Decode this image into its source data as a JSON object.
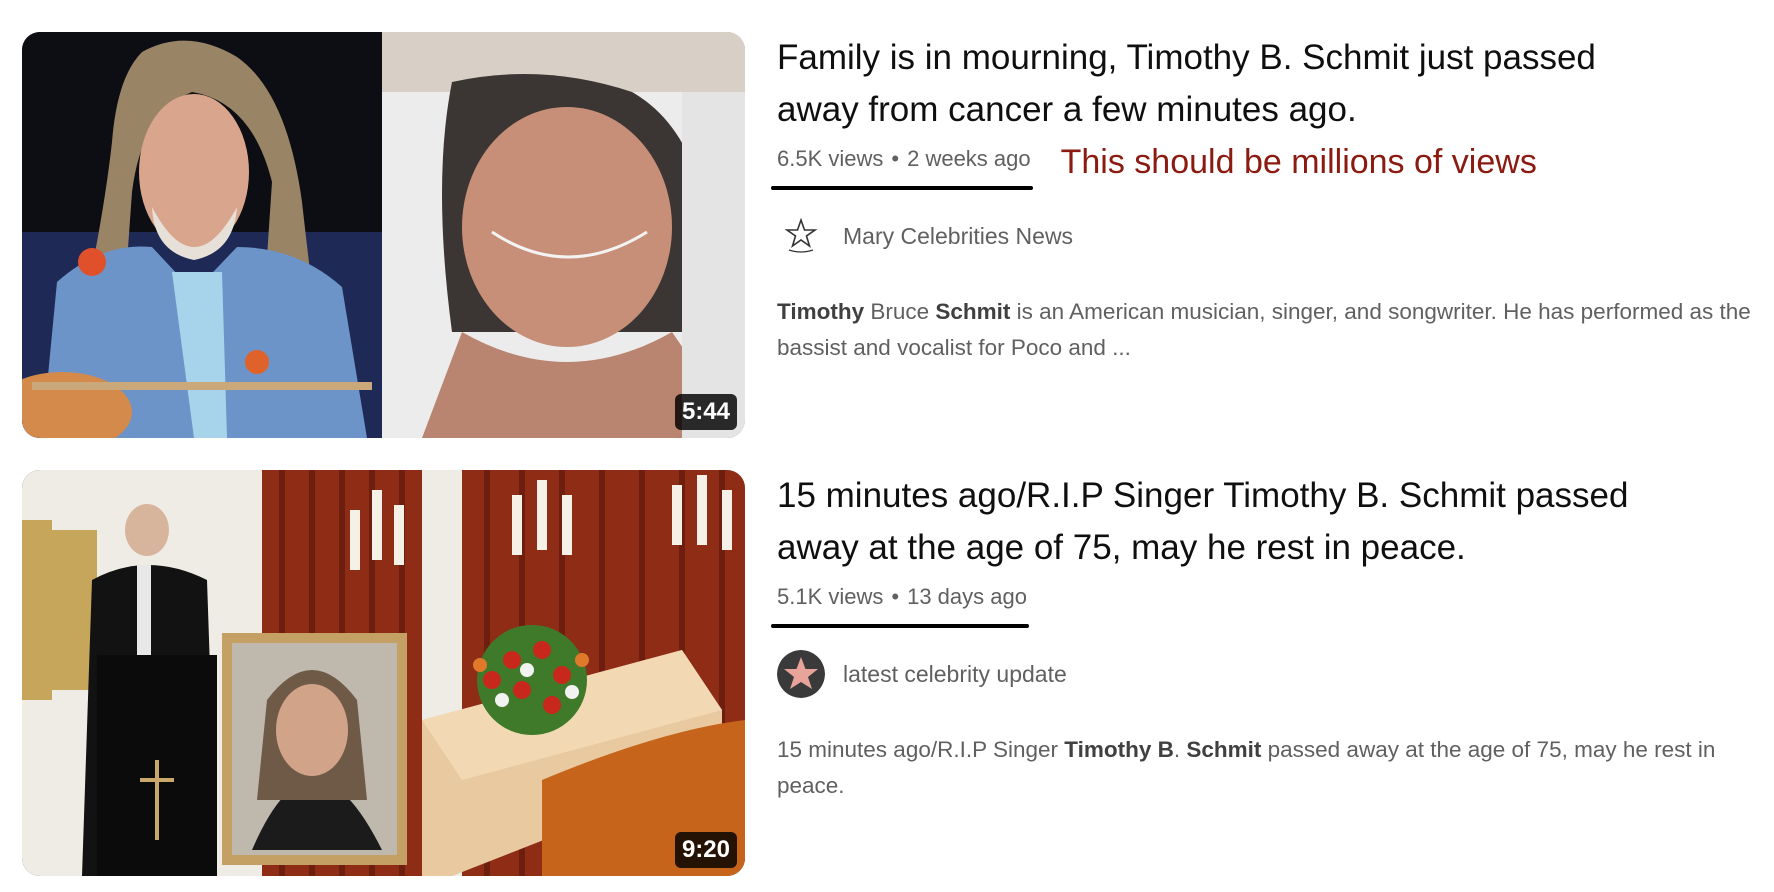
{
  "results": [
    {
      "title": "Family is in mourning, Timothy B. Schmit just passed away from cancer a few minutes ago.",
      "views": "6.5K views",
      "age": "2 weeks ago",
      "duration": "5:44",
      "channel": "Mary Celebrities News",
      "annotation": "This should be millions of views",
      "description": [
        {
          "text": "Timothy",
          "bold": true
        },
        {
          "text": " Bruce ",
          "bold": false
        },
        {
          "text": "Schmit",
          "bold": true
        },
        {
          "text": " is an American musician, singer, and songwriter. He has performed as the bassist and vocalist for Poco and ...",
          "bold": false
        }
      ]
    },
    {
      "title": "15 minutes ago/R.I.P Singer Timothy B. Schmit passed away at the age of 75, may he rest in peace.",
      "views": "5.1K views",
      "age": "13 days ago",
      "duration": "9:20",
      "channel": "latest celebrity update",
      "description": [
        {
          "text": "15 minutes ago/R.I.P Singer ",
          "bold": false
        },
        {
          "text": "Timothy B",
          "bold": true
        },
        {
          "text": ". ",
          "bold": false
        },
        {
          "text": "Schmit",
          "bold": true
        },
        {
          "text": " passed away at the age of 75, may he rest in peace.",
          "bold": false
        }
      ]
    }
  ],
  "colors": {
    "title": "#0f0f0f",
    "meta": "#606060",
    "annotation": "#8b1a10",
    "underline": "#000000"
  }
}
